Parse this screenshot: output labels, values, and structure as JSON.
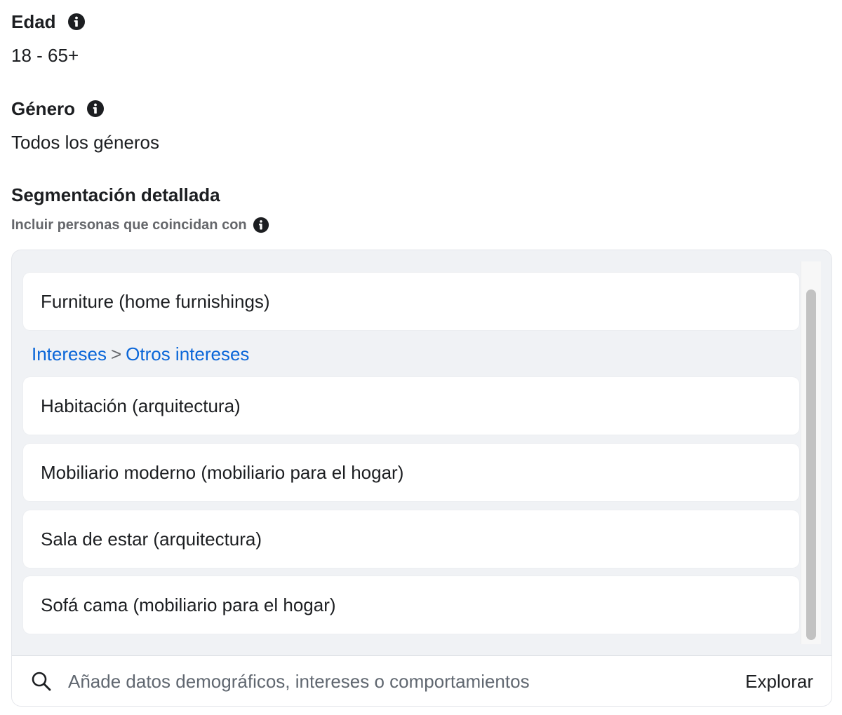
{
  "age": {
    "title": "Edad",
    "value": "18 - 65+"
  },
  "gender": {
    "title": "Género",
    "value": "Todos los géneros"
  },
  "detailed_targeting": {
    "title": "Segmentación detallada",
    "subtitle": "Incluir personas que coincidan con",
    "items_top": [
      "Furniture (home furnishings)"
    ],
    "breadcrumb": {
      "first": "Intereses",
      "separator": ">",
      "second": "Otros intereses"
    },
    "items": [
      "Habitación (arquitectura)",
      "Mobiliario moderno (mobiliario para el hogar)",
      "Sala de estar (arquitectura)",
      "Sofá cama (mobiliario para el hogar)"
    ],
    "search": {
      "placeholder": "Añade datos demográficos, intereses o comportamientos",
      "explore_label": "Explorar"
    }
  },
  "icons": {
    "info": "info-icon",
    "search": "search-icon"
  },
  "colors": {
    "link": "#0a66d8",
    "text": "#1c1e21",
    "muted": "#65676b",
    "panel_bg": "#f0f2f5"
  }
}
